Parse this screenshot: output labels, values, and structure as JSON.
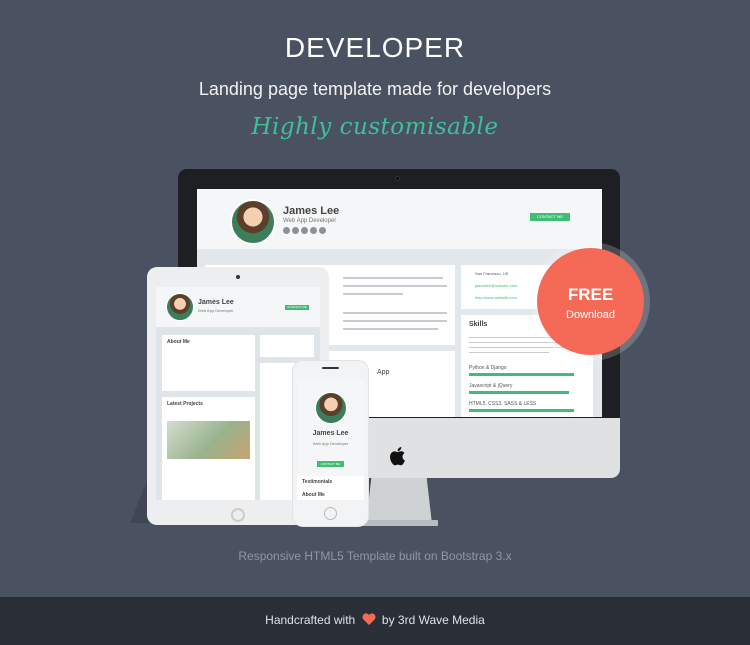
{
  "header": {
    "title": "DEVELOPER",
    "subtitle": "Landing page template made for developers",
    "tagline": "Highly customisable"
  },
  "mockup": {
    "profile_name": "James Lee",
    "profile_role": "Web App Developer",
    "contact_button": "CONTACT ME",
    "skills_heading": "Skills",
    "about_heading": "About Me",
    "latest_projects_heading": "Latest Projects",
    "location": "San Francisco, US",
    "email": "jameslee@website.com",
    "website": "http://www.website.com",
    "skill_1": "Python & Django",
    "skill_2": "Javascript & jQuery",
    "skill_3": "HTML5, CSS3, SASS & LESS",
    "skill_levels": [
      0.95,
      0.9,
      0.95
    ],
    "project_title": "App",
    "testimonials_heading": "Testimonials"
  },
  "badge": {
    "line1": "FREE",
    "line2": "Download"
  },
  "caption": "Responsive HTML5 Template built on Bootstrap 3.x",
  "footer": {
    "prefix": "Handcrafted with",
    "suffix": "by 3rd Wave Media"
  },
  "colors": {
    "background": "#4a5161",
    "footer": "#2a2e36",
    "accent_green": "#3fbf9c",
    "badge": "#f56a57"
  }
}
